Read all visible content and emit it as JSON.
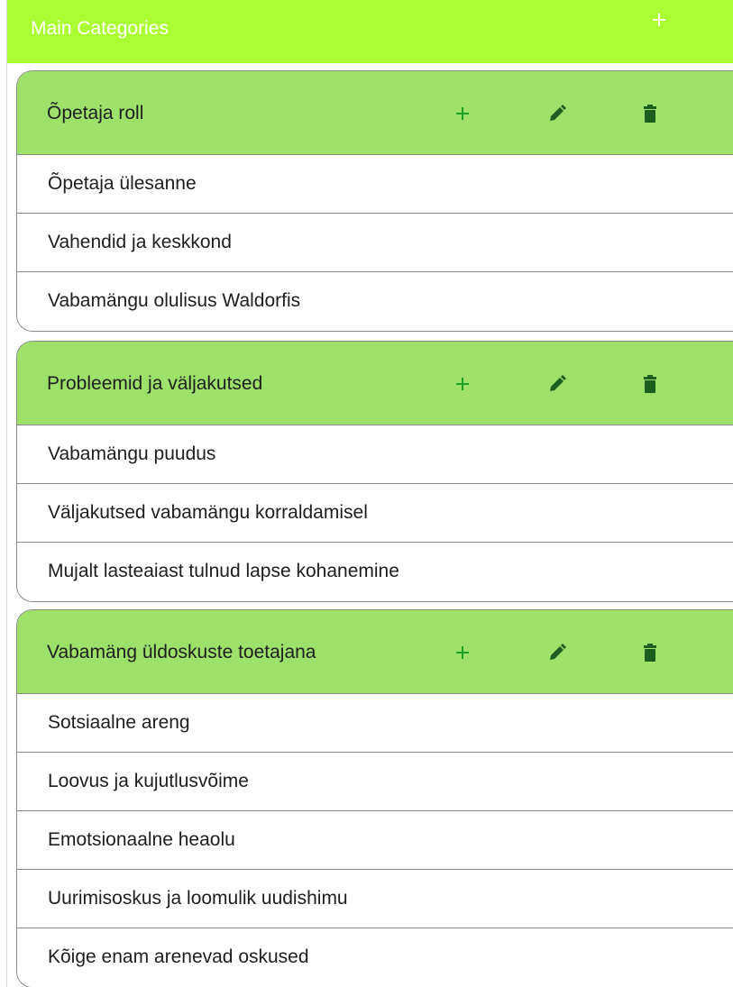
{
  "header": {
    "title": "Main Categories",
    "add_icon": "plus-icon",
    "color": "#aaff33"
  },
  "theme": {
    "category_header_color": "#9de06a",
    "icon_color": "#1f9d1f",
    "icon_dark": "#1b5e20"
  },
  "categories": [
    {
      "title": "Õpetaja roll",
      "actions": [
        "plus-icon",
        "pencil-icon",
        "trash-icon"
      ],
      "items": [
        "Õpetaja ülesanne",
        "Vahendid ja keskkond",
        "Vabamängu olulisus Waldorfis"
      ]
    },
    {
      "title": "Probleemid ja väljakutsed",
      "actions": [
        "plus-icon",
        "pencil-icon",
        "trash-icon"
      ],
      "items": [
        "Vabamängu puudus",
        "Väljakutsed vabamängu korraldamisel",
        "Mujalt lasteaiast tulnud lapse kohanemine"
      ]
    },
    {
      "title": "Vabamäng üldoskuste toetajana",
      "actions": [
        "plus-icon",
        "pencil-icon",
        "trash-icon"
      ],
      "items": [
        "Sotsiaalne areng",
        "Loovus ja kujutlusvõime",
        "Emotsionaalne heaolu",
        "Uurimisoskus ja loomulik uudishimu",
        "Kõige enam arenevad oskused"
      ]
    }
  ]
}
